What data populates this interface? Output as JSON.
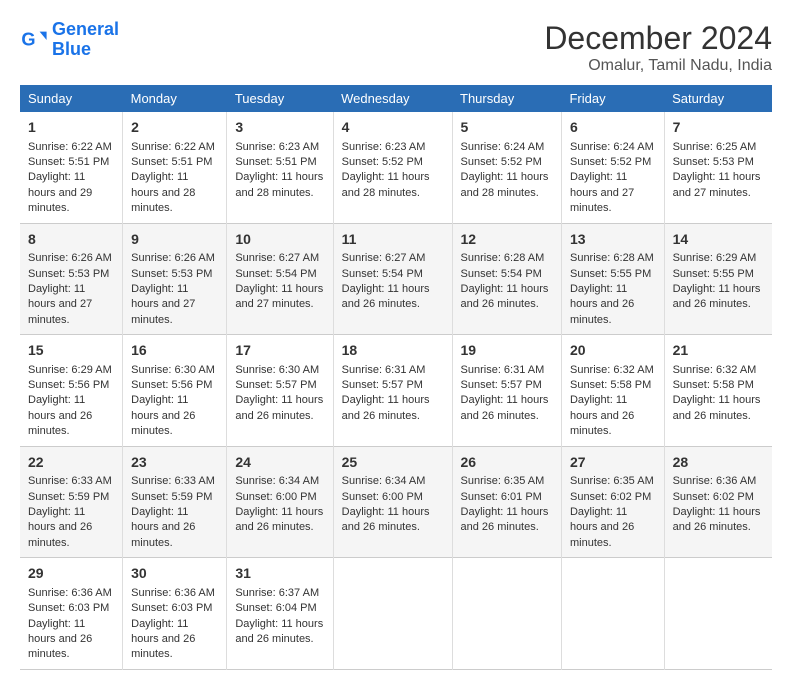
{
  "logo": {
    "line1": "General",
    "line2": "Blue"
  },
  "title": "December 2024",
  "subtitle": "Omalur, Tamil Nadu, India",
  "days_of_week": [
    "Sunday",
    "Monday",
    "Tuesday",
    "Wednesday",
    "Thursday",
    "Friday",
    "Saturday"
  ],
  "weeks": [
    [
      {
        "day": "1",
        "sunrise": "6:22 AM",
        "sunset": "5:51 PM",
        "daylight": "11 hours and 29 minutes."
      },
      {
        "day": "2",
        "sunrise": "6:22 AM",
        "sunset": "5:51 PM",
        "daylight": "11 hours and 28 minutes."
      },
      {
        "day": "3",
        "sunrise": "6:23 AM",
        "sunset": "5:51 PM",
        "daylight": "11 hours and 28 minutes."
      },
      {
        "day": "4",
        "sunrise": "6:23 AM",
        "sunset": "5:52 PM",
        "daylight": "11 hours and 28 minutes."
      },
      {
        "day": "5",
        "sunrise": "6:24 AM",
        "sunset": "5:52 PM",
        "daylight": "11 hours and 28 minutes."
      },
      {
        "day": "6",
        "sunrise": "6:24 AM",
        "sunset": "5:52 PM",
        "daylight": "11 hours and 27 minutes."
      },
      {
        "day": "7",
        "sunrise": "6:25 AM",
        "sunset": "5:53 PM",
        "daylight": "11 hours and 27 minutes."
      }
    ],
    [
      {
        "day": "8",
        "sunrise": "6:26 AM",
        "sunset": "5:53 PM",
        "daylight": "11 hours and 27 minutes."
      },
      {
        "day": "9",
        "sunrise": "6:26 AM",
        "sunset": "5:53 PM",
        "daylight": "11 hours and 27 minutes."
      },
      {
        "day": "10",
        "sunrise": "6:27 AM",
        "sunset": "5:54 PM",
        "daylight": "11 hours and 27 minutes."
      },
      {
        "day": "11",
        "sunrise": "6:27 AM",
        "sunset": "5:54 PM",
        "daylight": "11 hours and 26 minutes."
      },
      {
        "day": "12",
        "sunrise": "6:28 AM",
        "sunset": "5:54 PM",
        "daylight": "11 hours and 26 minutes."
      },
      {
        "day": "13",
        "sunrise": "6:28 AM",
        "sunset": "5:55 PM",
        "daylight": "11 hours and 26 minutes."
      },
      {
        "day": "14",
        "sunrise": "6:29 AM",
        "sunset": "5:55 PM",
        "daylight": "11 hours and 26 minutes."
      }
    ],
    [
      {
        "day": "15",
        "sunrise": "6:29 AM",
        "sunset": "5:56 PM",
        "daylight": "11 hours and 26 minutes."
      },
      {
        "day": "16",
        "sunrise": "6:30 AM",
        "sunset": "5:56 PM",
        "daylight": "11 hours and 26 minutes."
      },
      {
        "day": "17",
        "sunrise": "6:30 AM",
        "sunset": "5:57 PM",
        "daylight": "11 hours and 26 minutes."
      },
      {
        "day": "18",
        "sunrise": "6:31 AM",
        "sunset": "5:57 PM",
        "daylight": "11 hours and 26 minutes."
      },
      {
        "day": "19",
        "sunrise": "6:31 AM",
        "sunset": "5:57 PM",
        "daylight": "11 hours and 26 minutes."
      },
      {
        "day": "20",
        "sunrise": "6:32 AM",
        "sunset": "5:58 PM",
        "daylight": "11 hours and 26 minutes."
      },
      {
        "day": "21",
        "sunrise": "6:32 AM",
        "sunset": "5:58 PM",
        "daylight": "11 hours and 26 minutes."
      }
    ],
    [
      {
        "day": "22",
        "sunrise": "6:33 AM",
        "sunset": "5:59 PM",
        "daylight": "11 hours and 26 minutes."
      },
      {
        "day": "23",
        "sunrise": "6:33 AM",
        "sunset": "5:59 PM",
        "daylight": "11 hours and 26 minutes."
      },
      {
        "day": "24",
        "sunrise": "6:34 AM",
        "sunset": "6:00 PM",
        "daylight": "11 hours and 26 minutes."
      },
      {
        "day": "25",
        "sunrise": "6:34 AM",
        "sunset": "6:00 PM",
        "daylight": "11 hours and 26 minutes."
      },
      {
        "day": "26",
        "sunrise": "6:35 AM",
        "sunset": "6:01 PM",
        "daylight": "11 hours and 26 minutes."
      },
      {
        "day": "27",
        "sunrise": "6:35 AM",
        "sunset": "6:02 PM",
        "daylight": "11 hours and 26 minutes."
      },
      {
        "day": "28",
        "sunrise": "6:36 AM",
        "sunset": "6:02 PM",
        "daylight": "11 hours and 26 minutes."
      }
    ],
    [
      {
        "day": "29",
        "sunrise": "6:36 AM",
        "sunset": "6:03 PM",
        "daylight": "11 hours and 26 minutes."
      },
      {
        "day": "30",
        "sunrise": "6:36 AM",
        "sunset": "6:03 PM",
        "daylight": "11 hours and 26 minutes."
      },
      {
        "day": "31",
        "sunrise": "6:37 AM",
        "sunset": "6:04 PM",
        "daylight": "11 hours and 26 minutes."
      },
      null,
      null,
      null,
      null
    ]
  ]
}
